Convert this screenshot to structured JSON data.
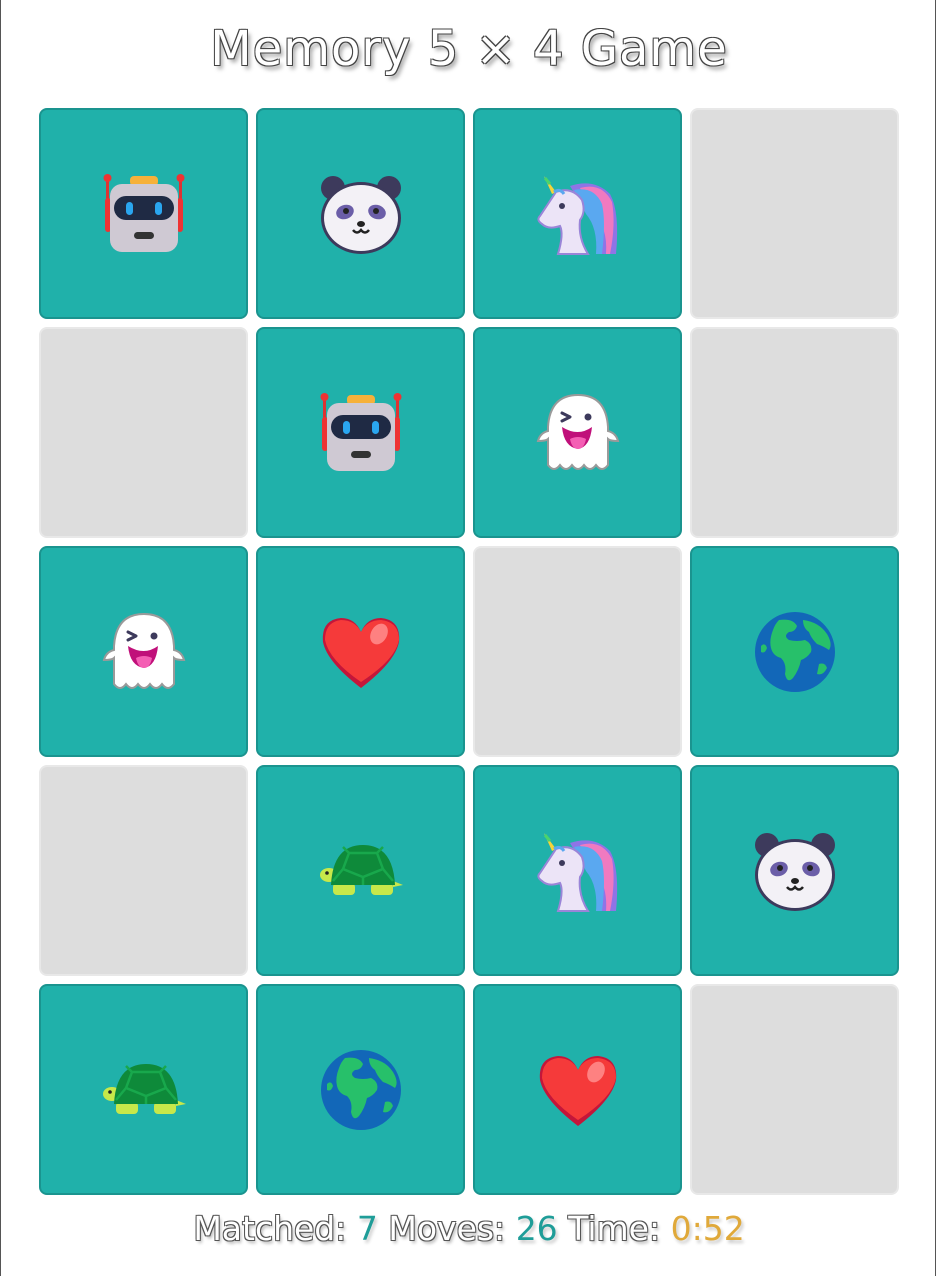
{
  "title": "Memory 5 × 4 Game",
  "stats": {
    "matched_label": "Matched:",
    "matched": "7",
    "moves_label": "Moves:",
    "moves": "26",
    "time_label": "Time:",
    "time": "0:52"
  },
  "colors": {
    "open_card": "#20b1aa",
    "hidden_card": "#dddddd",
    "counter_teal": "#1f9d98",
    "timer_gold": "#e0a93a"
  },
  "cards": [
    {
      "state": "open",
      "icon": "robot-icon"
    },
    {
      "state": "open",
      "icon": "panda-icon"
    },
    {
      "state": "open",
      "icon": "unicorn-icon"
    },
    {
      "state": "hidden",
      "icon": ""
    },
    {
      "state": "hidden",
      "icon": ""
    },
    {
      "state": "open",
      "icon": "robot-icon"
    },
    {
      "state": "open",
      "icon": "ghost-icon"
    },
    {
      "state": "hidden",
      "icon": ""
    },
    {
      "state": "open",
      "icon": "ghost-icon"
    },
    {
      "state": "open",
      "icon": "heart-icon"
    },
    {
      "state": "hidden",
      "icon": ""
    },
    {
      "state": "open",
      "icon": "globe-icon"
    },
    {
      "state": "hidden",
      "icon": ""
    },
    {
      "state": "open",
      "icon": "turtle-icon"
    },
    {
      "state": "open",
      "icon": "unicorn-icon"
    },
    {
      "state": "open",
      "icon": "panda-icon"
    },
    {
      "state": "open",
      "icon": "turtle-icon"
    },
    {
      "state": "open",
      "icon": "globe-icon"
    },
    {
      "state": "open",
      "icon": "heart-icon"
    },
    {
      "state": "hidden",
      "icon": ""
    }
  ]
}
